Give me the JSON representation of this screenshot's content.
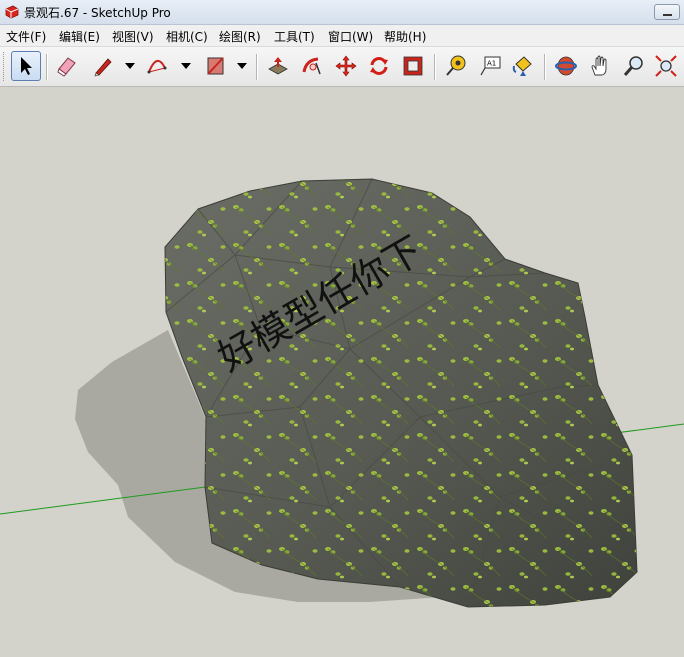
{
  "window": {
    "title": "景观石.67 - SketchUp Pro"
  },
  "menu": {
    "items": [
      {
        "label": "文件(F)"
      },
      {
        "label": "编辑(E)"
      },
      {
        "label": "视图(V)"
      },
      {
        "label": "相机(C)"
      },
      {
        "label": "绘图(R)"
      },
      {
        "label": "工具(T)"
      },
      {
        "label": "窗口(W)"
      },
      {
        "label": "帮助(H)"
      }
    ]
  },
  "toolbar": {
    "tools": [
      {
        "icon": "select-arrow-icon",
        "active": true
      },
      {
        "icon": "eraser-icon"
      },
      {
        "icon": "pencil-line-icon"
      },
      {
        "icon": "arc-icon"
      },
      {
        "icon": "rectangle-icon"
      },
      {
        "icon": "push-pull-icon"
      },
      {
        "icon": "follow-me-icon"
      },
      {
        "icon": "move-icon"
      },
      {
        "icon": "rotate-icon"
      },
      {
        "icon": "offset-icon"
      },
      {
        "icon": "tape-measure-icon"
      },
      {
        "icon": "text-icon"
      },
      {
        "icon": "paint-bucket-icon"
      },
      {
        "icon": "orbit-icon"
      },
      {
        "icon": "pan-hand-icon"
      },
      {
        "icon": "zoom-icon"
      },
      {
        "icon": "zoom-extents-icon"
      }
    ],
    "text_tool_label": "A1"
  },
  "viewport": {
    "watermark": "好模型任你下",
    "colors": {
      "background": "#d3d3cb",
      "shadow": "#a9a9a2",
      "rock": "#5f625a",
      "moss": "#9cc13a",
      "axis_green": "#1f9a1f"
    }
  }
}
